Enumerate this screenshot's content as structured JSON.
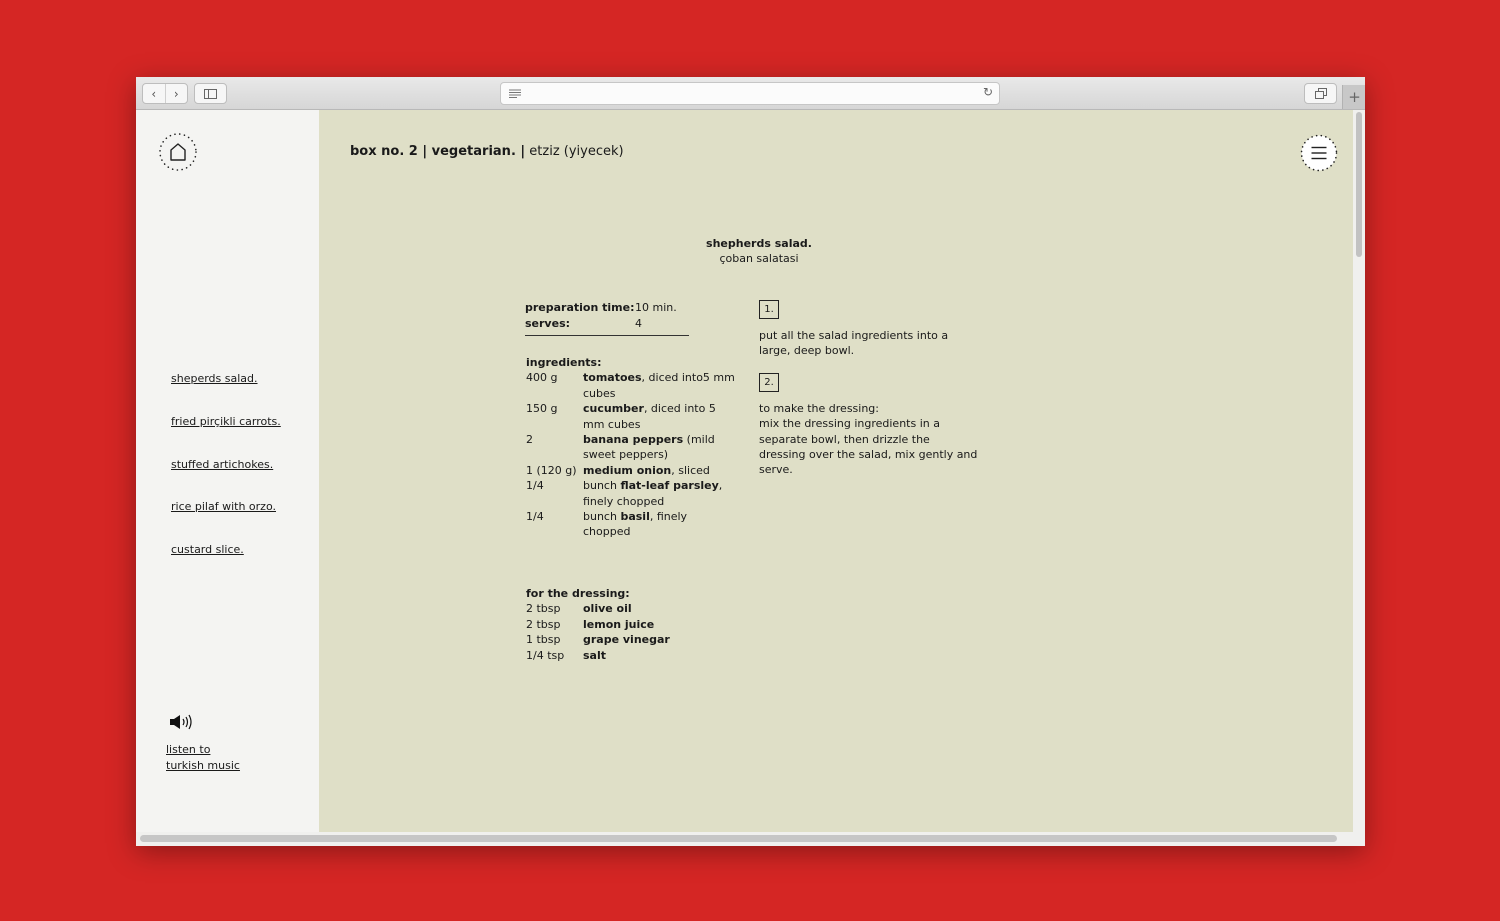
{
  "browser": {
    "url": "",
    "back_glyph": "‹",
    "forward_glyph": "›",
    "reload_glyph": "↻",
    "newtab_glyph": "+"
  },
  "header": {
    "title_bold": "box no. 2 | vegetarian. |",
    "title_regular": " etziz (yiyecek)"
  },
  "sidebar": {
    "recipes": [
      {
        "label": "sheperds salad."
      },
      {
        "label": "fried pirçikli carrots."
      },
      {
        "label": "stuffed artichokes."
      },
      {
        "label": "rice pilaf with orzo."
      },
      {
        "label": "custard slice."
      }
    ],
    "music_link": "listen to\nturkish music"
  },
  "recipe": {
    "title": "shepherds salad.",
    "subtitle": "çoban salatasi",
    "meta": [
      {
        "label": "preparation time:",
        "value": "10 min."
      },
      {
        "label": "serves:",
        "value": "4"
      }
    ],
    "ingredients_label": "ingredients:",
    "ingredients": [
      {
        "qty": "400 g",
        "bold": "tomatoes",
        "rest": ", diced into5 mm cubes"
      },
      {
        "qty": "150 g",
        "bold": "cucumber",
        "rest": ", diced into 5 mm cubes"
      },
      {
        "qty": "2",
        "bold": "banana peppers",
        "rest": " (mild sweet peppers)"
      },
      {
        "qty": "1 (120 g)",
        "bold": "medium onion",
        "rest": ", sliced"
      },
      {
        "qty": "1/4",
        "pre": "bunch ",
        "bold": "flat-leaf parsley",
        "rest": ", finely chopped"
      },
      {
        "qty": "1/4",
        "pre": "bunch ",
        "bold": "basil",
        "rest": ", finely chopped"
      }
    ],
    "dressing_label": "for the dressing:",
    "dressing": [
      {
        "qty": "2 tbsp",
        "item": "olive oil"
      },
      {
        "qty": "2 tbsp",
        "item": "lemon juice"
      },
      {
        "qty": "1 tbsp",
        "item": "grape vinegar"
      },
      {
        "qty": "1/4 tsp",
        "item": "salt"
      }
    ],
    "steps": [
      {
        "number": "1.",
        "text": "put all the salad ingredients into a large, deep bowl."
      },
      {
        "number": "2.",
        "text": "to make the dressing:\nmix the dressing ingredients in a separate bowl, then drizzle the dressing over the salad, mix gently and serve."
      }
    ]
  },
  "colors": {
    "background": "#d52624",
    "content": "#dfdfc7",
    "sidebar": "#f4f4f2"
  }
}
